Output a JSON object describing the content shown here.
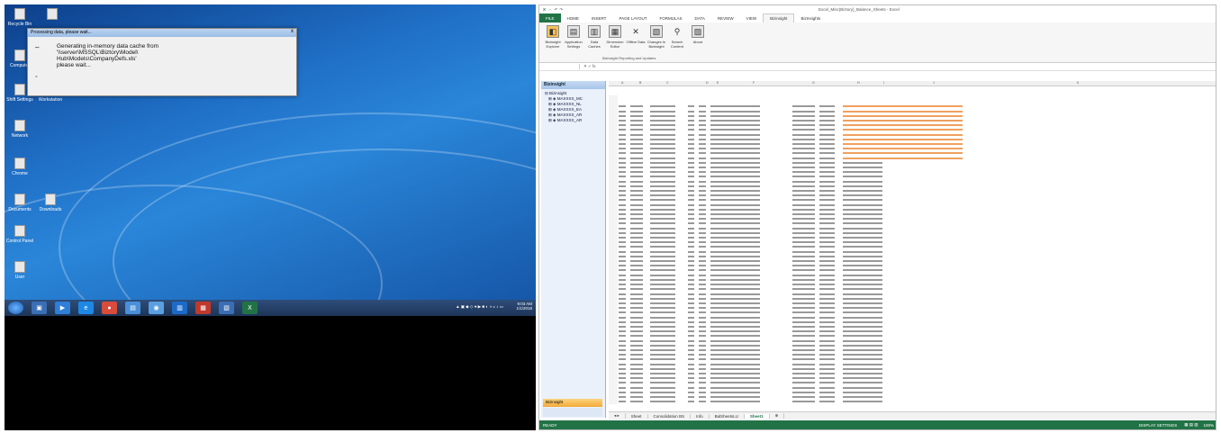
{
  "dialog": {
    "title": "Processing data, please wait...",
    "message_lines": [
      "Generating in-memory data cache from",
      "'\\\\server\\MSSQL\\Biztory\\Model\\",
      "Hub\\Models\\CompanyDefs.xls'",
      "please wait..."
    ],
    "close": "x"
  },
  "desktop_icons": [
    {
      "label": "Recycle Bin"
    },
    {
      "label": ""
    },
    {
      "label": "Computer"
    },
    {
      "label": "Shift Settings"
    },
    {
      "label": "Workstation"
    },
    {
      "label": "Network"
    },
    {
      "label": "Chrome"
    },
    {
      "label": "Documents"
    },
    {
      "label": "Downloads"
    },
    {
      "label": "Control Panel"
    },
    {
      "label": "User"
    }
  ],
  "taskbar": {
    "time": "9:03 AM",
    "date": "1/1/2018"
  },
  "excel": {
    "title": "Excel_Misc(Biztory)_Balance_Sheets - Excel",
    "tabs": [
      "FILE",
      "HOME",
      "INSERT",
      "PAGE LAYOUT",
      "FORMULAS",
      "DATA",
      "REVIEW",
      "VIEW",
      "Bizinsight",
      "BizInsights"
    ],
    "ribbon_buttons": [
      "Bizinsight Explorer",
      "Application Settings",
      "Data Caches",
      "Dimension Editor",
      "Offline Data",
      "Changes In Bizinsight",
      "Search Content",
      "About"
    ],
    "ribbon_group": "Bizinsight Reporting and Updates",
    "namebox": "",
    "formula_value": "",
    "pane_title": "Bizinsight",
    "tree": [
      "Bizinsight",
      "MAXXXX_MC",
      "MAXXXX_NL",
      "MAXXXX_EA",
      "MAXXXX_AR",
      "MAXXXX_AR"
    ],
    "pane_footer": "Bizinsight",
    "col_headers": [
      "A",
      "B",
      "C",
      "D",
      "E",
      "F",
      "G",
      "H",
      "I",
      "J",
      "K"
    ],
    "sheet_tabs": [
      "Sheet",
      "Consolidation BS",
      "Info",
      "BalSheetsLU",
      "Sheet1"
    ],
    "status_left": "READY",
    "status_right": "DISPLAY SETTINGS",
    "zoom": "100%"
  }
}
